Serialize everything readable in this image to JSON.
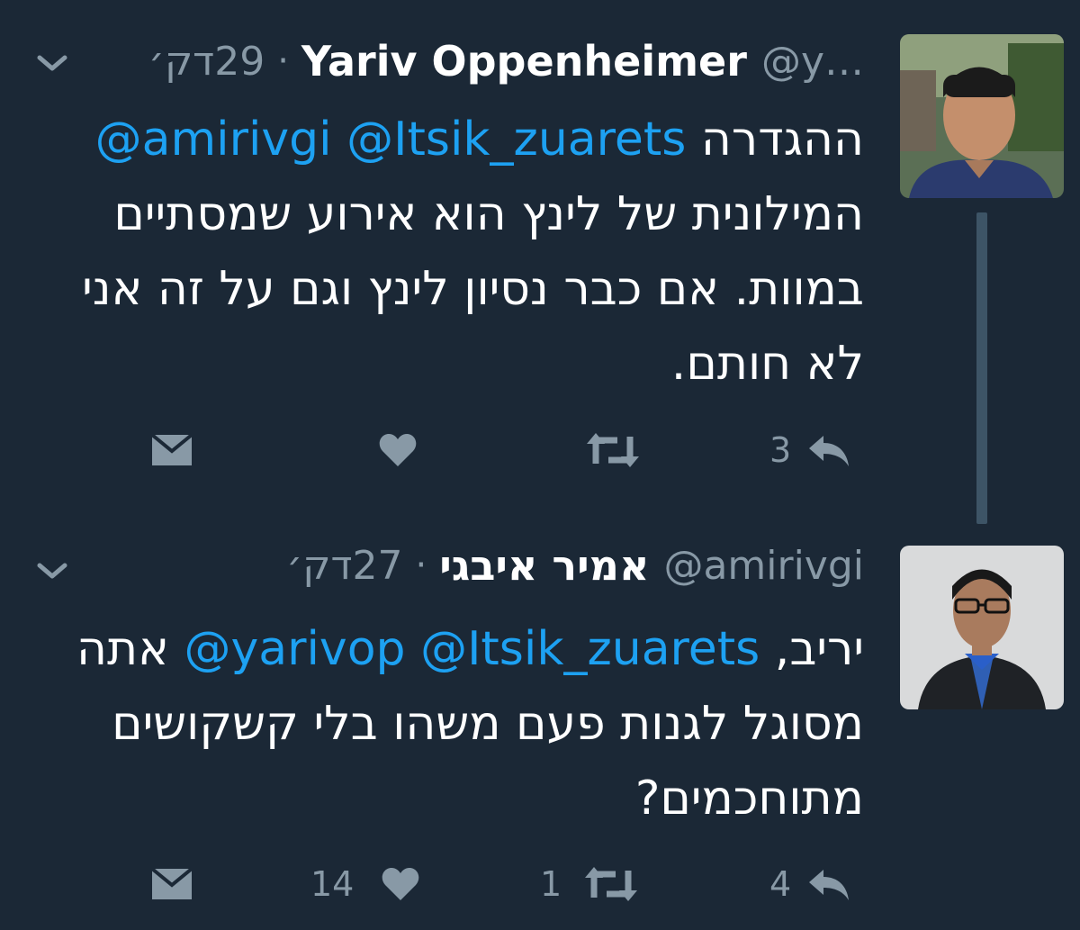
{
  "tweets": [
    {
      "author_name": "Yariv Oppenheimer",
      "author_handle": "@y…",
      "separator": "·",
      "time": "29דק׳",
      "mentions": [
        "@Itsik_zuarets",
        "@amirivgi"
      ],
      "text_start": "ההגדרה",
      "text_rest": "המילונית של לינץ הוא אירוע שמסתיים במוות. אם כבר נסיון לינץ וגם על זה אני לא חותם.",
      "counts": {
        "reply": "3",
        "retweet": "",
        "like": ""
      },
      "avatar": "avatar-photo-icon"
    },
    {
      "author_name": "אמיר איבגי",
      "author_handle": "@amirivgi",
      "separator": "·",
      "time": "27דק׳",
      "mentions": [
        "@Itsik_zuarets",
        "@yarivop"
      ],
      "text_start": "יריב,",
      "text_rest": "אתה מסוגל לגנות פעם משהו בלי קשקושים מתוחכמים?",
      "counts": {
        "reply": "4",
        "retweet": "1",
        "like": "14"
      },
      "avatar": "avatar-photo-icon"
    }
  ],
  "colors": {
    "background": "#1b2836",
    "text": "#ffffff",
    "muted": "#8899a6",
    "mention": "#1da1f2",
    "thread_line": "#3d5466"
  },
  "icons": [
    "chevron-down-icon",
    "reply-icon",
    "retweet-icon",
    "like-icon",
    "direct-message-icon"
  ]
}
